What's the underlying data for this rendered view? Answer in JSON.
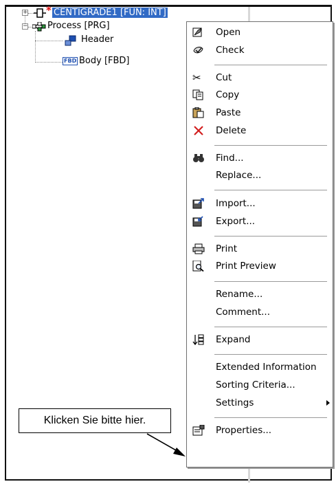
{
  "tree": {
    "items": [
      {
        "label": "CENTIGRADE1 [FUN: INT]",
        "marker": "*",
        "expander": "+"
      },
      {
        "label": "Process [PRG]",
        "expander": "−"
      },
      {
        "label": "Header"
      },
      {
        "label": "Body [FBD]",
        "icon_text": "FBD"
      }
    ]
  },
  "context_menu": {
    "items": [
      {
        "label": "Open",
        "icon": "open-icon"
      },
      {
        "label": "Check",
        "icon": "check-icon"
      },
      {
        "label": "Cut",
        "icon": "scissors-icon"
      },
      {
        "label": "Copy",
        "icon": "copy-icon"
      },
      {
        "label": "Paste",
        "icon": "paste-icon"
      },
      {
        "label": "Delete",
        "icon": "delete-icon"
      },
      {
        "label": "Find...",
        "icon": "binoculars-icon"
      },
      {
        "label": "Replace..."
      },
      {
        "label": "Import...",
        "icon": "import-icon"
      },
      {
        "label": "Export...",
        "icon": "export-icon"
      },
      {
        "label": "Print",
        "icon": "printer-icon"
      },
      {
        "label": "Print Preview",
        "icon": "print-preview-icon"
      },
      {
        "label": "Rename..."
      },
      {
        "label": "Comment..."
      },
      {
        "label": "Expand",
        "icon": "expand-icon"
      },
      {
        "label": "Extended Information"
      },
      {
        "label": "Sorting Criteria..."
      },
      {
        "label": "Settings",
        "submenu": true
      },
      {
        "label": "Properties...",
        "icon": "properties-icon"
      }
    ]
  },
  "callout": {
    "text": "Klicken Sie bitte hier."
  },
  "colors": {
    "selection": "#316ac5",
    "delete_red": "#d21f1f",
    "marker_red": "#e01010"
  }
}
